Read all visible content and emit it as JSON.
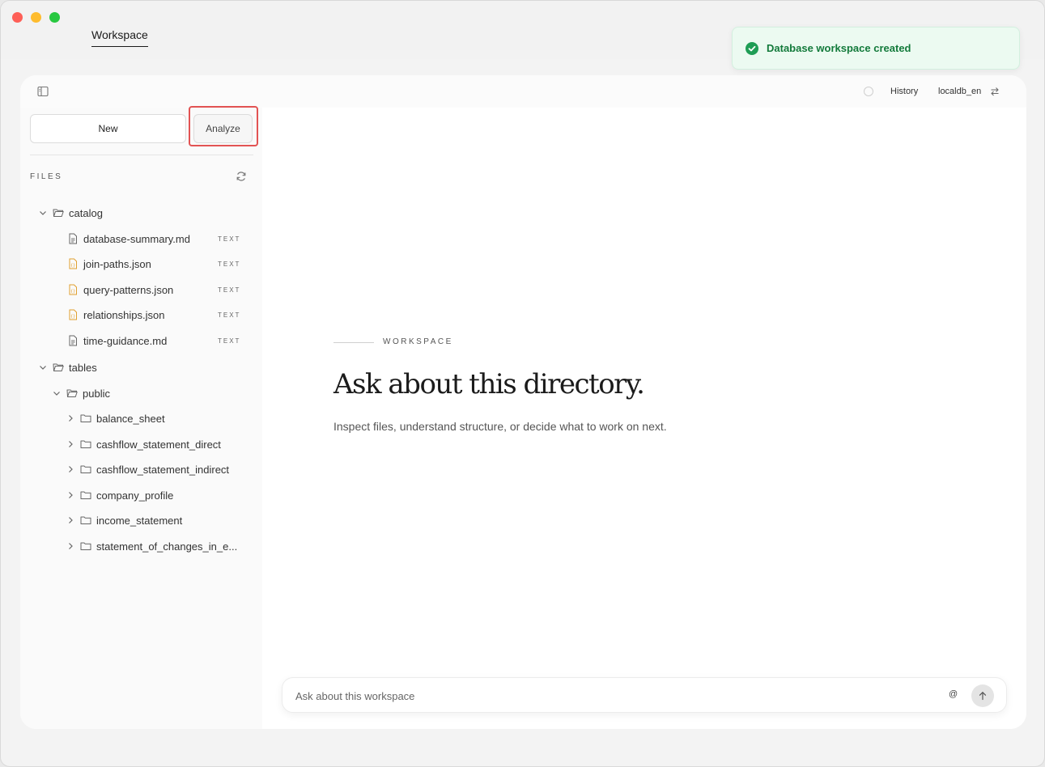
{
  "window": {
    "tab_label": "Workspace"
  },
  "toast": {
    "message": "Database workspace created"
  },
  "header": {
    "history_label": "History",
    "database_name": "localdb_en"
  },
  "sidebar": {
    "new_label": "New",
    "analyze_label": "Analyze",
    "files_label": "FILES",
    "tree": [
      {
        "label": "catalog",
        "type": "folder",
        "depth": 0,
        "expanded": true
      },
      {
        "label": "database-summary.md",
        "type": "md",
        "depth": 1,
        "tag": "TEXT"
      },
      {
        "label": "join-paths.json",
        "type": "json",
        "depth": 1,
        "tag": "TEXT"
      },
      {
        "label": "query-patterns.json",
        "type": "json",
        "depth": 1,
        "tag": "TEXT"
      },
      {
        "label": "relationships.json",
        "type": "json",
        "depth": 1,
        "tag": "TEXT"
      },
      {
        "label": "time-guidance.md",
        "type": "md",
        "depth": 1,
        "tag": "TEXT"
      },
      {
        "label": "tables",
        "type": "folder",
        "depth": 0,
        "expanded": true
      },
      {
        "label": "public",
        "type": "folder",
        "depth": 1,
        "expanded": true
      },
      {
        "label": "balance_sheet",
        "type": "folder",
        "depth": 2,
        "expanded": false
      },
      {
        "label": "cashflow_statement_direct",
        "type": "folder",
        "depth": 2,
        "expanded": false
      },
      {
        "label": "cashflow_statement_indirect",
        "type": "folder",
        "depth": 2,
        "expanded": false
      },
      {
        "label": "company_profile",
        "type": "folder",
        "depth": 2,
        "expanded": false
      },
      {
        "label": "income_statement",
        "type": "folder",
        "depth": 2,
        "expanded": false
      },
      {
        "label": "statement_of_changes_in_e...",
        "type": "folder",
        "depth": 2,
        "expanded": false
      }
    ]
  },
  "main": {
    "eyebrow": "WORKSPACE",
    "headline": "Ask about this directory.",
    "subtext": "Inspect files, understand structure, or decide what to work on next.",
    "composer_placeholder": "Ask about this workspace",
    "mention_label": "@"
  },
  "colors": {
    "toast_bg": "#ecfaf1",
    "toast_text": "#137a3b",
    "highlight": "#e25353",
    "json_icon": "#e0a030"
  }
}
